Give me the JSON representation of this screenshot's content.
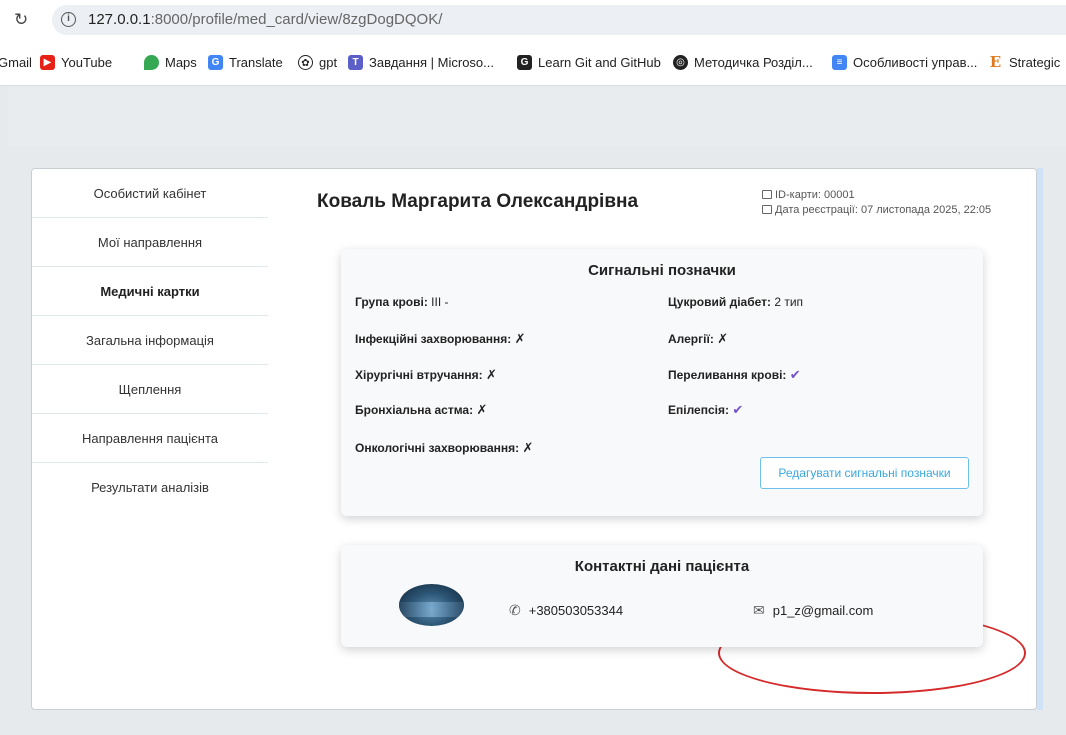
{
  "browser": {
    "url_host": "127.0.0.1",
    "url_path": ":8000/profile/med_card/view/8zgDogDQOK/",
    "bookmarks": [
      {
        "label": "Gmail"
      },
      {
        "label": "YouTube"
      },
      {
        "label": "Maps"
      },
      {
        "label": "Translate"
      },
      {
        "label": "gpt"
      },
      {
        "label": "Завдання | Microso..."
      },
      {
        "label": "Learn Git and GitHub"
      },
      {
        "label": "Методичка Розділ..."
      },
      {
        "label": "Особливості управ..."
      },
      {
        "label": "Strategic"
      }
    ]
  },
  "sidebar": {
    "items": [
      {
        "label": "Особистий кабінет"
      },
      {
        "label": "Мої направлення"
      },
      {
        "label": "Медичні картки"
      },
      {
        "label": "Загальна інформація"
      },
      {
        "label": "Щеплення"
      },
      {
        "label": "Направлення пацієнта"
      },
      {
        "label": "Результати аналізів"
      }
    ]
  },
  "patient": {
    "name": "Коваль Маргарита Олександрівна",
    "card_id": "ID-карти: 00001",
    "reg_date": "Дата реєстрації: 07 листопада 2025, 22:05"
  },
  "signals": {
    "title": "Сигнальні позначки",
    "blood_group_label": "Група крові:",
    "blood_group_value": "III -",
    "diabetes_label": "Цукровий діабет:",
    "diabetes_value": "2 тип",
    "infectious_label": "Інфекційні захворювання:",
    "infectious_value": "✗",
    "allergies_label": "Алергії:",
    "allergies_value": "✗",
    "surgery_label": "Хірургічні втручання:",
    "surgery_value": "✗",
    "transfusion_label": "Переливання крові:",
    "transfusion_value": "✔",
    "asthma_label": "Бронхіальна астма:",
    "asthma_value": "✗",
    "epilepsy_label": "Епілепсія:",
    "epilepsy_value": "✔",
    "oncology_label": "Онкологічні захворювання:",
    "oncology_value": "✗",
    "edit_button": "Редагувати сигнальні позначки"
  },
  "contacts": {
    "title": "Контактні дані пацієнта",
    "phone": "+380503053344",
    "email": "p1_z@gmail.com"
  },
  "colors": {
    "accent": "#39a7de",
    "check": "#7352c7",
    "highlight": "#d52a2a"
  }
}
